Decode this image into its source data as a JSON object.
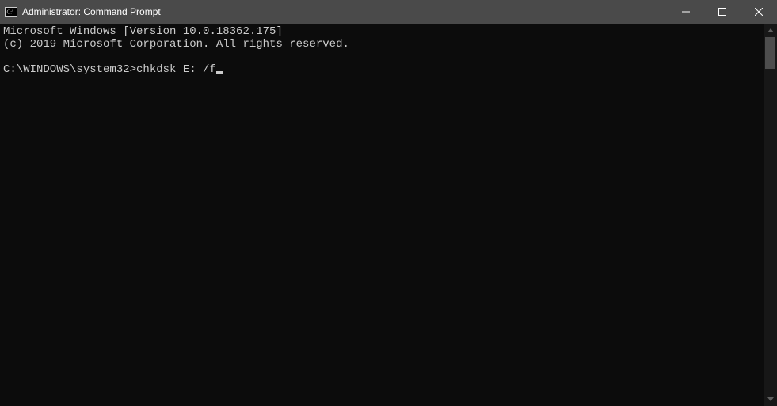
{
  "window": {
    "title": "Administrator: Command Prompt"
  },
  "console": {
    "line1": "Microsoft Windows [Version 10.0.18362.175]",
    "line2": "(c) 2019 Microsoft Corporation. All rights reserved.",
    "blank": "",
    "prompt": "C:\\WINDOWS\\system32>",
    "command": "chkdsk E: /f"
  }
}
